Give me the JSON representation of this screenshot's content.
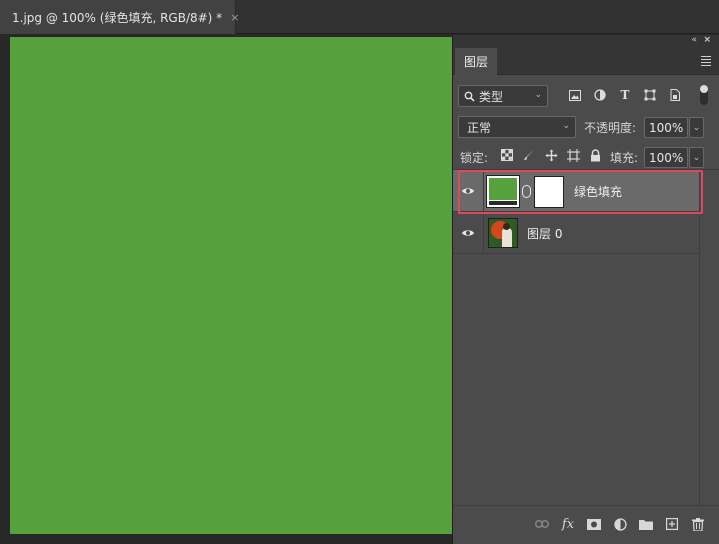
{
  "document_tab": {
    "title": "1.jpg @ 100% (绿色填充, RGB/8#) *",
    "close": "×"
  },
  "canvas": {
    "fill_color": "#57a03e"
  },
  "panel": {
    "collapse_glyph": "«",
    "close_glyph": "×",
    "tab_label": "图层",
    "filter": {
      "label": "类型",
      "icons": [
        "image-filter-icon",
        "adjustment-filter-icon",
        "type-filter-icon",
        "shape-filter-icon",
        "smart-object-filter-icon"
      ]
    },
    "blend_mode": "正常",
    "opacity_label": "不透明度:",
    "opacity_value": "100%",
    "lock_label": "锁定:",
    "fill_label": "填充:",
    "fill_value": "100%",
    "layers": [
      {
        "name": "绿色填充",
        "selected": true,
        "type": "fill"
      },
      {
        "name": "图层 0",
        "selected": false,
        "type": "pixel"
      }
    ],
    "footer_icons": [
      "link-layers-icon",
      "fx-icon",
      "add-mask-icon",
      "adjustment-layer-icon",
      "group-folder-icon",
      "new-layer-icon",
      "trash-icon"
    ]
  },
  "colors": {
    "highlight": "#e3475d",
    "selected_row": "#6a6a6a",
    "panel_bg": "#4b4b4b"
  }
}
